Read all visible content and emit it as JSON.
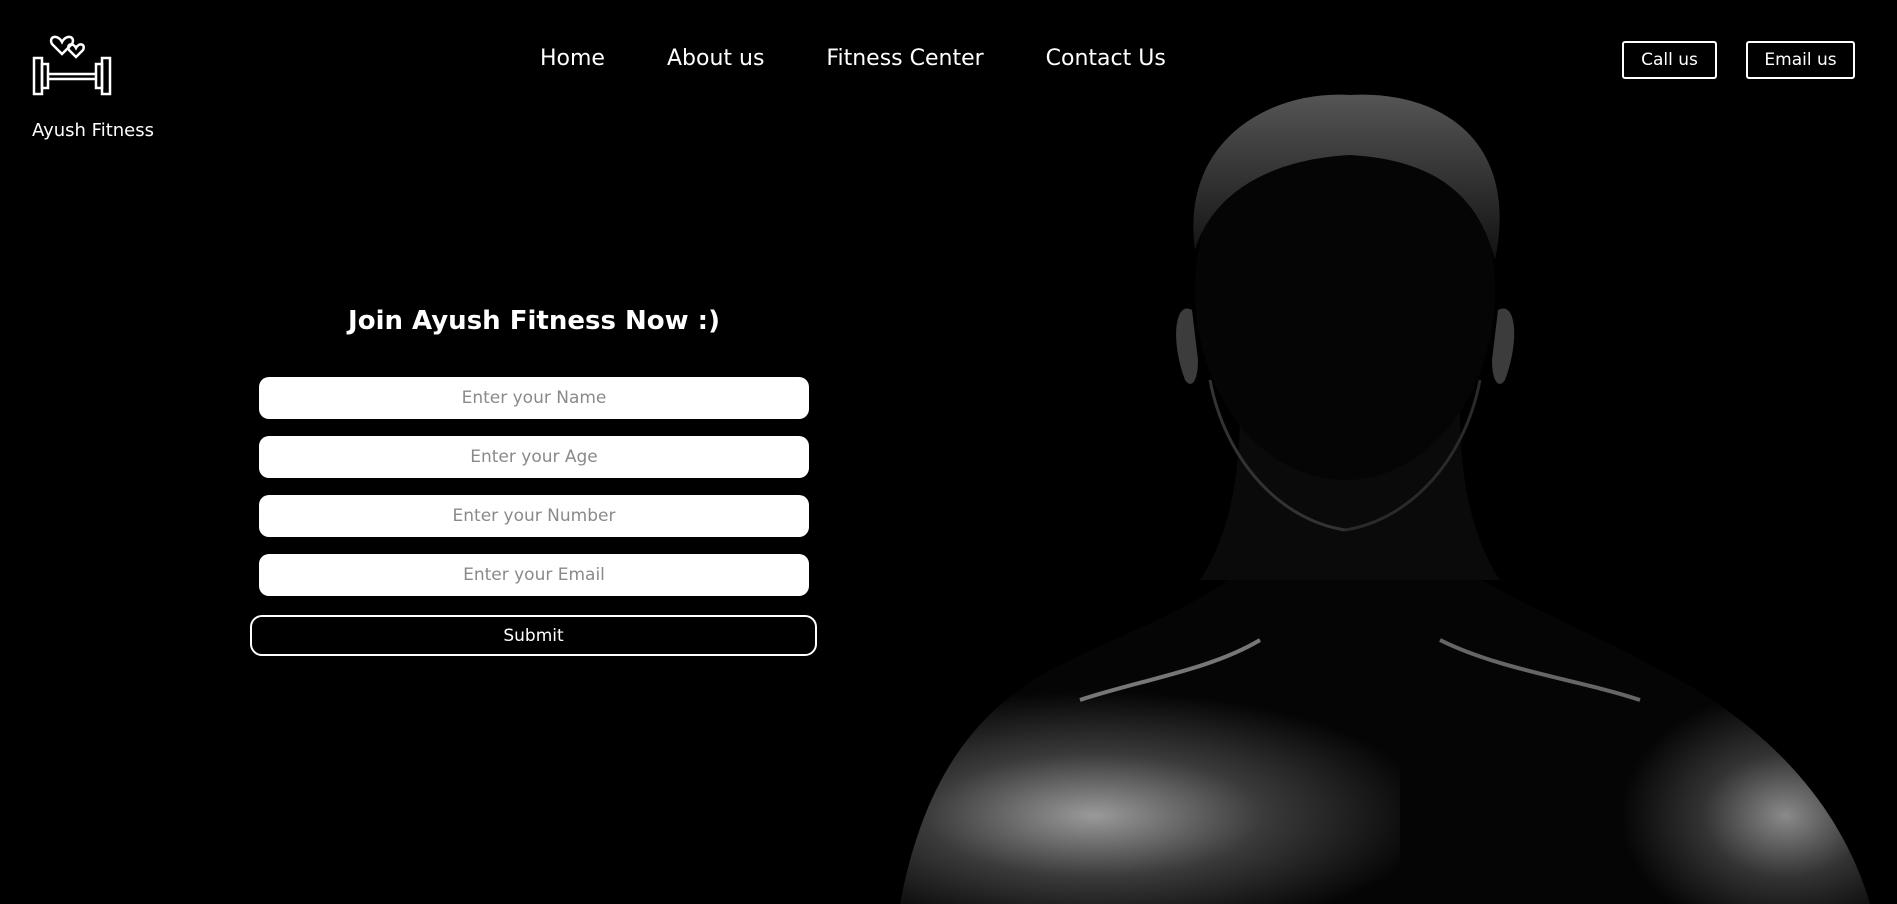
{
  "brand": {
    "name": "Ayush Fitness",
    "logo_icon": "dumbbell-hearts-icon"
  },
  "nav": {
    "items": [
      {
        "label": "Home"
      },
      {
        "label": "About us"
      },
      {
        "label": "Fitness Center"
      },
      {
        "label": "Contact Us"
      }
    ]
  },
  "header_buttons": {
    "call": "Call us",
    "email": "Email us"
  },
  "form": {
    "title": "Join Ayush Fitness Now :)",
    "name_placeholder": "Enter your Name",
    "age_placeholder": "Enter your Age",
    "number_placeholder": "Enter your Number",
    "email_placeholder": "Enter your Email",
    "submit_label": "Submit"
  },
  "colors": {
    "background": "#000000",
    "text": "#ffffff",
    "field_bg": "#ffffff"
  }
}
